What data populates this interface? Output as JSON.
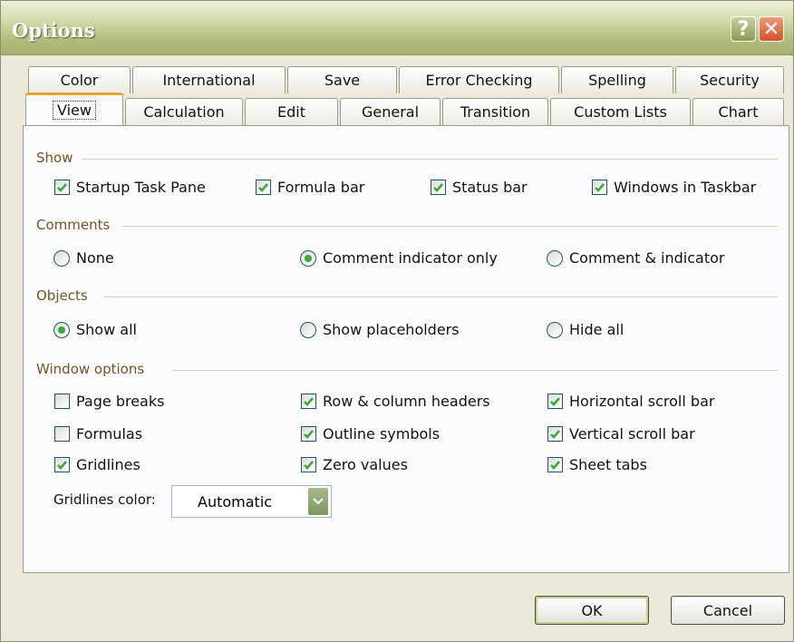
{
  "window": {
    "title": "Options",
    "help_label": "?",
    "close_label": "✕"
  },
  "tabs_back": [
    "Color",
    "International",
    "Save",
    "Error Checking",
    "Spelling",
    "Security"
  ],
  "tabs_front": [
    "View",
    "Calculation",
    "Edit",
    "General",
    "Transition",
    "Custom Lists",
    "Chart"
  ],
  "active_tab": "View",
  "show": {
    "title": "Show",
    "items": [
      {
        "label": "Startup Task Pane",
        "checked": true
      },
      {
        "label": "Formula bar",
        "checked": true
      },
      {
        "label": "Status bar",
        "checked": true
      },
      {
        "label": "Windows in Taskbar",
        "checked": true
      }
    ]
  },
  "comments": {
    "title": "Comments",
    "options": [
      {
        "label": "None",
        "selected": false
      },
      {
        "label": "Comment indicator only",
        "selected": true
      },
      {
        "label": "Comment & indicator",
        "selected": false
      }
    ]
  },
  "objects": {
    "title": "Objects",
    "options": [
      {
        "label": "Show all",
        "selected": true
      },
      {
        "label": "Show placeholders",
        "selected": false
      },
      {
        "label": "Hide all",
        "selected": false
      }
    ]
  },
  "window_options": {
    "title": "Window options",
    "items": [
      {
        "label": "Page breaks",
        "checked": false
      },
      {
        "label": "Row & column headers",
        "checked": true
      },
      {
        "label": "Horizontal scroll bar",
        "checked": true
      },
      {
        "label": "Formulas",
        "checked": false
      },
      {
        "label": "Outline symbols",
        "checked": true
      },
      {
        "label": "Vertical scroll bar",
        "checked": true
      },
      {
        "label": "Gridlines",
        "checked": true
      },
      {
        "label": "Zero values",
        "checked": true
      },
      {
        "label": "Sheet tabs",
        "checked": true
      }
    ],
    "gridlines_color_label": "Gridlines color:",
    "gridlines_color_value": "Automatic"
  },
  "buttons": {
    "ok": "OK",
    "cancel": "Cancel"
  },
  "colors": {
    "accent": "#e6a136",
    "check": "#3ca53c",
    "section_title": "#7a5220"
  }
}
